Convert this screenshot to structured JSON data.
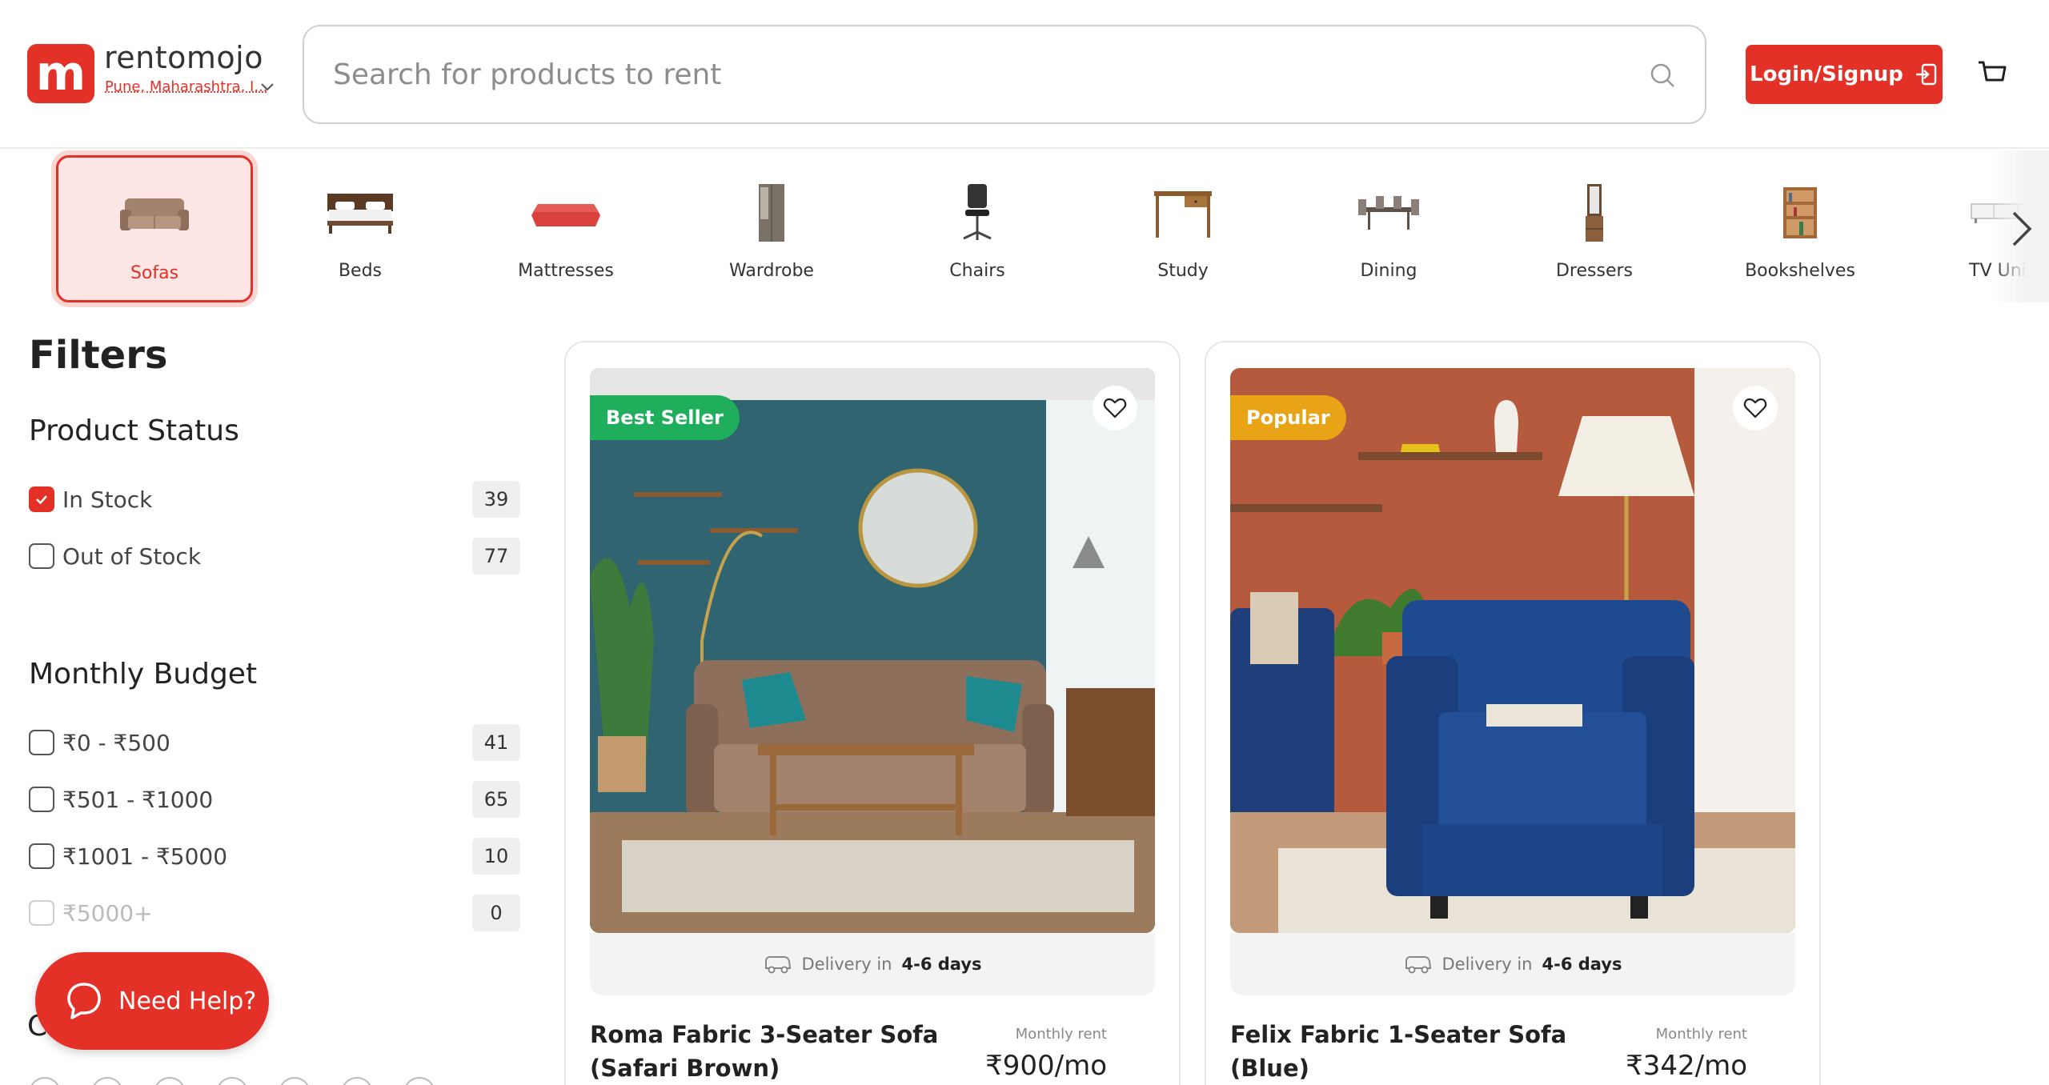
{
  "header": {
    "brand": "rentomojo",
    "location": "Pune, Maharashtra, I...",
    "search_placeholder": "Search for products to rent",
    "login_label": "Login/Signup"
  },
  "categories": [
    {
      "label": "Sofas",
      "active": true
    },
    {
      "label": "Beds"
    },
    {
      "label": "Mattresses"
    },
    {
      "label": "Wardrobe"
    },
    {
      "label": "Chairs"
    },
    {
      "label": "Study"
    },
    {
      "label": "Dining"
    },
    {
      "label": "Dressers"
    },
    {
      "label": "Bookshelves"
    },
    {
      "label": "TV Units"
    }
  ],
  "filters": {
    "title": "Filters",
    "product_status": {
      "title": "Product Status",
      "options": [
        {
          "label": "In Stock",
          "count": "39",
          "checked": true
        },
        {
          "label": "Out of Stock",
          "count": "77",
          "checked": false
        }
      ]
    },
    "monthly_budget": {
      "title": "Monthly Budget",
      "options": [
        {
          "label": "₹0 - ₹500",
          "count": "41"
        },
        {
          "label": "₹501 - ₹1000",
          "count": "65"
        },
        {
          "label": "₹1001 - ₹5000",
          "count": "10"
        },
        {
          "label": "₹5000+",
          "count": "0",
          "disabled": true
        }
      ]
    },
    "next_group_initial": "C"
  },
  "help": {
    "label": "Need Help?"
  },
  "products": [
    {
      "badge": "Best Seller",
      "badge_color": "#1fae5b",
      "delivery_prefix": "Delivery in",
      "delivery_days": "4-6 days",
      "name": "Roma Fabric 3-Seater Sofa (Safari Brown)",
      "rent_label": "Monthly rent",
      "price": "₹900/mo"
    },
    {
      "badge": "Popular",
      "badge_color": "#e8a317",
      "delivery_prefix": "Delivery in",
      "delivery_days": "4-6 days",
      "name": "Felix Fabric 1-Seater Sofa (Blue)",
      "rent_label": "Monthly rent",
      "price": "₹342/mo"
    }
  ],
  "colors": {
    "brand": "#e33128"
  },
  "icons": [
    "search-icon",
    "cart-icon",
    "login-icon",
    "chevron-down-icon",
    "chevron-right-icon",
    "heart-icon",
    "truck-icon",
    "chat-icon",
    "check-icon"
  ]
}
